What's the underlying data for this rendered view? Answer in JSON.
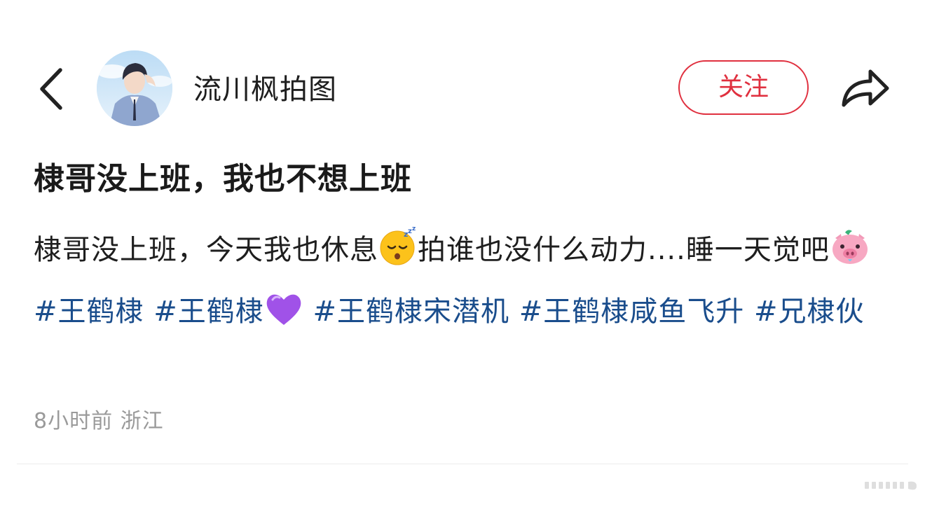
{
  "header": {
    "author_name": "流川枫拍图",
    "follow_label": "关注",
    "back_icon": "chevron-left-icon",
    "share_icon": "share-arrow-icon"
  },
  "post": {
    "title": "棣哥没上班，我也不想上班",
    "body_intro": "棣哥没上班，今天我也休息",
    "sleep_emoji": "sleeping-face-emoji",
    "body_middle": "拍谁也没什么动力....睡一天觉吧",
    "pig_emoji": "pig-face-emoji",
    "hashtags": [
      "#王鹤棣",
      "#王鹤棣",
      "#王鹤棣宋潜机",
      "#王鹤棣咸鱼飞升",
      "#兄棣伙"
    ],
    "heart_emoji": "purple-heart-emoji"
  },
  "meta": {
    "time": "8小时前",
    "location": "浙江"
  },
  "colors": {
    "accent_red": "#e0303f",
    "hashtag_blue": "#1a4d8c",
    "meta_gray": "#9a9a9a"
  }
}
